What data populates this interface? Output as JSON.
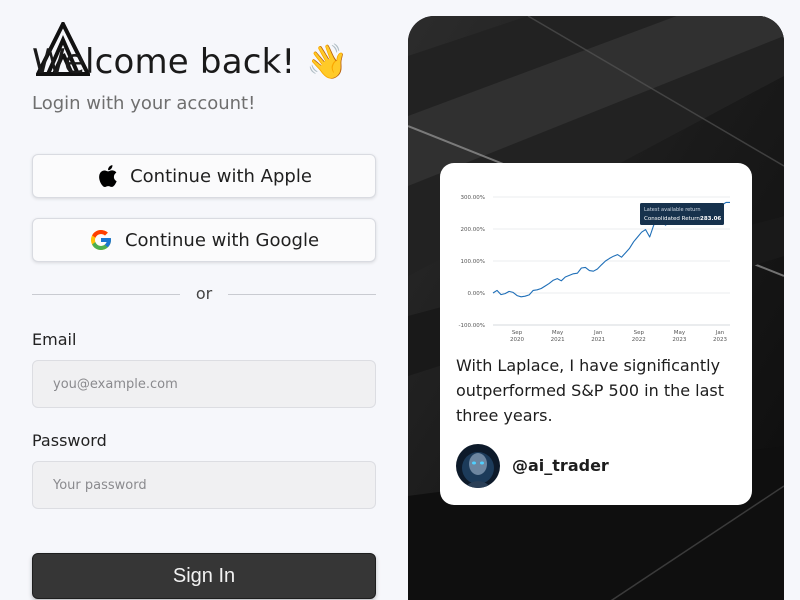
{
  "login": {
    "title": "Welcome back! 👋",
    "subtitle": "Login with your account!",
    "apple_label": "Continue with Apple",
    "google_label": "Continue with Google",
    "divider_text": "or",
    "email_label": "Email",
    "email_placeholder": "you@example.com",
    "password_label": "Password",
    "password_placeholder": "Your password",
    "signin_label": "Sign In"
  },
  "testimonial": {
    "quote": "With Laplace, I have significantly outperformed S&P 500 in the last three years.",
    "handle": "@ai_trader"
  },
  "chart_data": {
    "type": "line",
    "y_ticks": [
      "300.00%",
      "200.00%",
      "100.00%",
      "0.00%",
      "-100.00%"
    ],
    "y_tick_values": [
      300,
      200,
      100,
      0,
      -100
    ],
    "x_ticks": [
      [
        "Sep",
        "2020"
      ],
      [
        "May",
        "2021"
      ],
      [
        "Jan",
        "2021"
      ],
      [
        "Sep",
        "2022"
      ],
      [
        "May",
        "2023"
      ],
      [
        "Jan",
        "2023"
      ]
    ],
    "ylim": [
      -100,
      350
    ],
    "tooltip": {
      "line1": "Latest available return",
      "line2_label": "Consolidated Return:",
      "line2_value": "283.06"
    },
    "line_color": "#1f6fb8",
    "values": [
      0,
      8,
      -5,
      -2,
      5,
      2,
      -8,
      -12,
      -10,
      -6,
      8,
      10,
      14,
      22,
      30,
      40,
      45,
      38,
      50,
      55,
      60,
      62,
      78,
      80,
      70,
      68,
      75,
      88,
      100,
      108,
      115,
      120,
      112,
      126,
      140,
      160,
      175,
      190,
      198,
      175,
      212,
      228,
      220,
      212,
      240,
      255,
      238,
      232,
      250,
      262,
      245,
      240,
      255,
      270,
      262,
      252,
      260,
      275,
      283,
      283
    ]
  },
  "colors": {
    "page_bg": "#f6f7fb",
    "signin_bg": "#363636",
    "panel_bg": "#141414"
  }
}
